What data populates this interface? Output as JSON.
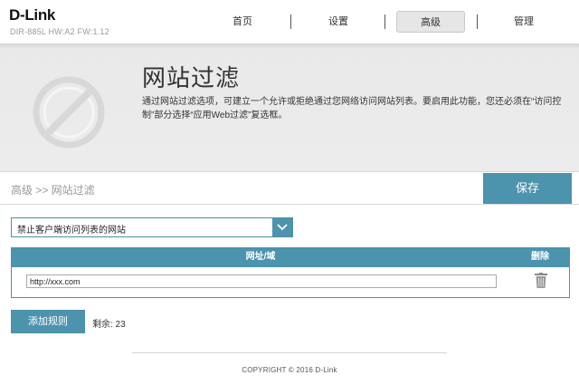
{
  "brand": {
    "logo": "D-Link",
    "model": "DIR-885L HW:A2 FW:1.12"
  },
  "nav": {
    "items": [
      "首页",
      "设置",
      "高级",
      "管理"
    ],
    "active_index": 2
  },
  "hero": {
    "title": "网站过滤",
    "description": "通过网站过滤选项，可建立一个允许或拒绝通过您网络访问网站列表。要启用此功能，您还必须在“访问控制”部分选择“应用Web过滤”复选框。"
  },
  "breadcrumb": "高级 >> 网站过滤",
  "save_label": "保存",
  "filter_mode": {
    "selected": "禁止客户端访问列表的网站"
  },
  "table": {
    "headers": {
      "url": "网址/域",
      "delete": "删除"
    },
    "rows": [
      {
        "url": "http://xxx.com"
      }
    ]
  },
  "add_rule_label": "添加规则",
  "remaining": "剩余: 23",
  "footer": {
    "copyright": "COPYRIGHT © 2016 D-Link"
  },
  "colors": {
    "accent": "#4c93ad",
    "hero_bg": "#ececec"
  },
  "icons": {
    "hero": "block-icon",
    "dropdown": "chevron-down-icon",
    "delete": "trash-icon"
  }
}
